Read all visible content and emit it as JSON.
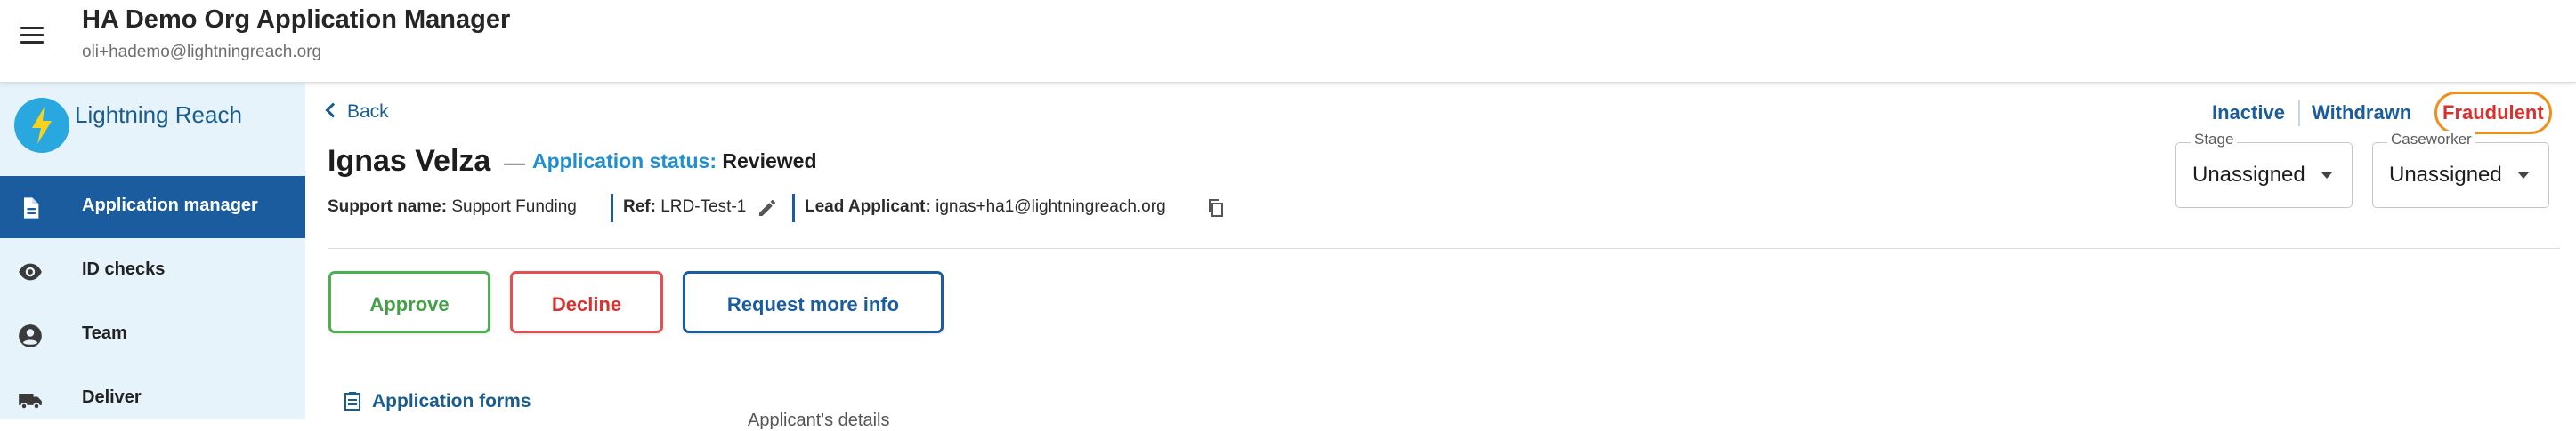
{
  "header": {
    "title": "HA Demo Org Application Manager",
    "email": "oli+hademo@lightningreach.org"
  },
  "sidebar": {
    "logo_text": "Lightning Reach",
    "items": [
      {
        "label": "Application manager",
        "icon": "document-icon",
        "active": true
      },
      {
        "label": "ID checks",
        "icon": "eye-icon",
        "active": false
      },
      {
        "label": "Team",
        "icon": "account-circle-icon",
        "active": false
      },
      {
        "label": "Deliver",
        "icon": "truck-icon",
        "active": false
      }
    ]
  },
  "main": {
    "back_label": "Back",
    "applicant_name": "Ignas Velza",
    "name_separator": "—",
    "status_label": "Application status:",
    "status_value": "Reviewed",
    "support_name_key": "Support name:",
    "support_name_value": "Support Funding",
    "ref_key": "Ref:",
    "ref_value": "LRD-Test-1",
    "lead_key": "Lead Applicant:",
    "lead_value": "ignas+ha1@lightningreach.org",
    "buttons": {
      "approve": "Approve",
      "decline": "Decline",
      "request_more": "Request more info"
    },
    "forms_link": "Application forms",
    "partial_text": "Applicant's details"
  },
  "actions": {
    "inactive": "Inactive",
    "withdrawn": "Withdrawn",
    "fraudulent": "Fraudulent"
  },
  "selects": {
    "stage": {
      "label": "Stage",
      "value": "Unassigned"
    },
    "caseworker": {
      "label": "Caseworker",
      "value": "Unassigned"
    }
  },
  "colors": {
    "primary": "#1a5c9e",
    "sidebar_bg": "#e6f3fb",
    "approve": "#43a047",
    "decline": "#d9322e",
    "annotation": "#f0901b",
    "status_label": "#1f8fd0"
  }
}
